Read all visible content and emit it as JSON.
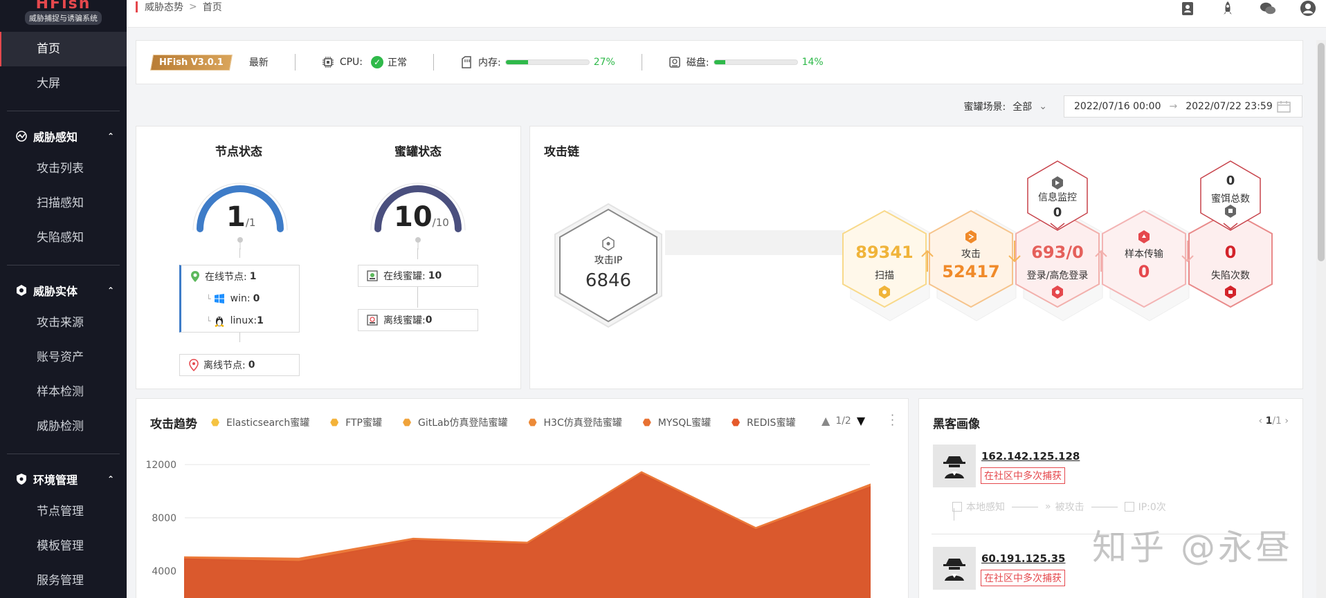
{
  "sidebar": {
    "logo_title": "HFish",
    "logo_sub": "威胁捕捉与诱骗系统",
    "top_items": [
      {
        "label": "首页"
      },
      {
        "label": "大屏"
      }
    ],
    "groups": [
      {
        "label": "威胁感知",
        "items": [
          {
            "label": "攻击列表"
          },
          {
            "label": "扫描感知"
          },
          {
            "label": "失陷感知"
          }
        ]
      },
      {
        "label": "威胁实体",
        "items": [
          {
            "label": "攻击来源"
          },
          {
            "label": "账号资产"
          },
          {
            "label": "样本检测"
          },
          {
            "label": "威胁检测"
          }
        ]
      },
      {
        "label": "环境管理",
        "items": [
          {
            "label": "节点管理"
          },
          {
            "label": "模板管理"
          },
          {
            "label": "服务管理"
          }
        ]
      }
    ]
  },
  "breadcrumb": {
    "parent": "威胁态势",
    "sep": ">",
    "current": "首页"
  },
  "status": {
    "version": "HFish V3.0.1",
    "version_state": "最新",
    "cpu_label": "CPU:",
    "cpu_state": "正常",
    "mem_label": "内存:",
    "mem_pct": "27%",
    "mem_fraction": 0.27,
    "disk_label": "磁盘:",
    "disk_pct": "14%",
    "disk_fraction": 0.14
  },
  "filter": {
    "scene_label": "蜜罐场景:",
    "scene_value": "全部",
    "date_start": "2022/07/16 00:00",
    "date_arrow": "→",
    "date_end": "2022/07/22 23:59"
  },
  "node_status": {
    "title": "节点状态",
    "value": "1",
    "total": "/1",
    "online_label": "在线节点:",
    "online_value": "1",
    "win_label": "win:",
    "win_value": "0",
    "linux_label": "linux:",
    "linux_value": "1",
    "offline_label": "离线节点:",
    "offline_value": "0"
  },
  "honeypot_status": {
    "title": "蜜罐状态",
    "value": "10",
    "total": "/10",
    "online_label": "在线蜜罐:",
    "online_value": "10",
    "offline_label": "离线蜜罐:",
    "offline_value": "0"
  },
  "attack_chain": {
    "title": "攻击链",
    "attack_ip_label": "攻击IP",
    "attack_ip_value": "6846",
    "scan_value": "89341",
    "scan_label": "扫描",
    "attack_label": "攻击",
    "attack_value": "52417",
    "login_value": "693/0",
    "login_label": "登录/高危登录",
    "sample_label": "样本传输",
    "sample_value": "0",
    "fall_value": "0",
    "fall_label": "失陷次数",
    "monitor_label": "信息监控",
    "monitor_value": "0",
    "bait_value": "0",
    "bait_label": "蜜饵总数"
  },
  "trend": {
    "title": "攻击趋势",
    "legend": [
      {
        "name": "Elasticsearch蜜罐",
        "color": "#f5c342"
      },
      {
        "name": "FTP蜜罐",
        "color": "#f3b239"
      },
      {
        "name": "GitLab仿真登陆蜜罐",
        "color": "#f0a33a"
      },
      {
        "name": "H3C仿真登陆蜜罐",
        "color": "#ec8a38"
      },
      {
        "name": "MYSQL蜜罐",
        "color": "#e87132"
      },
      {
        "name": "REDIS蜜罐",
        "color": "#e55a2b"
      }
    ],
    "page": "1/2"
  },
  "chart_data": {
    "type": "area",
    "ylim": [
      2000,
      12000
    ],
    "yticks": [
      "12000",
      "8000",
      "4000"
    ],
    "series": [
      {
        "name": "REDIS蜜罐",
        "values": [
          4900,
          4700,
          6300,
          6000,
          11300,
          7100,
          10300
        ]
      },
      {
        "name": "MYSQL蜜罐",
        "values": [
          5050,
          4950,
          6450,
          6150,
          11450,
          7250,
          10500
        ]
      }
    ]
  },
  "hackers": {
    "title": "黑客画像",
    "page": "1",
    "page_total": "/1",
    "items": [
      {
        "ip": "162.142.125.128",
        "tag": "在社区中多次捕获",
        "flow": [
          "本地感知",
          "被攻击",
          "IP:0次"
        ]
      },
      {
        "ip": "60.191.125.35",
        "tag": "在社区中多次捕获"
      }
    ]
  },
  "watermark": "知乎 @永昼",
  "colors": {
    "accent": "#e5484d",
    "sidebar_bg": "#161823",
    "ok": "#2fb94a",
    "gauge_node": "#3e7cc8",
    "gauge_pot": "#4a4f7e",
    "chart_fill": "#d9572c"
  }
}
